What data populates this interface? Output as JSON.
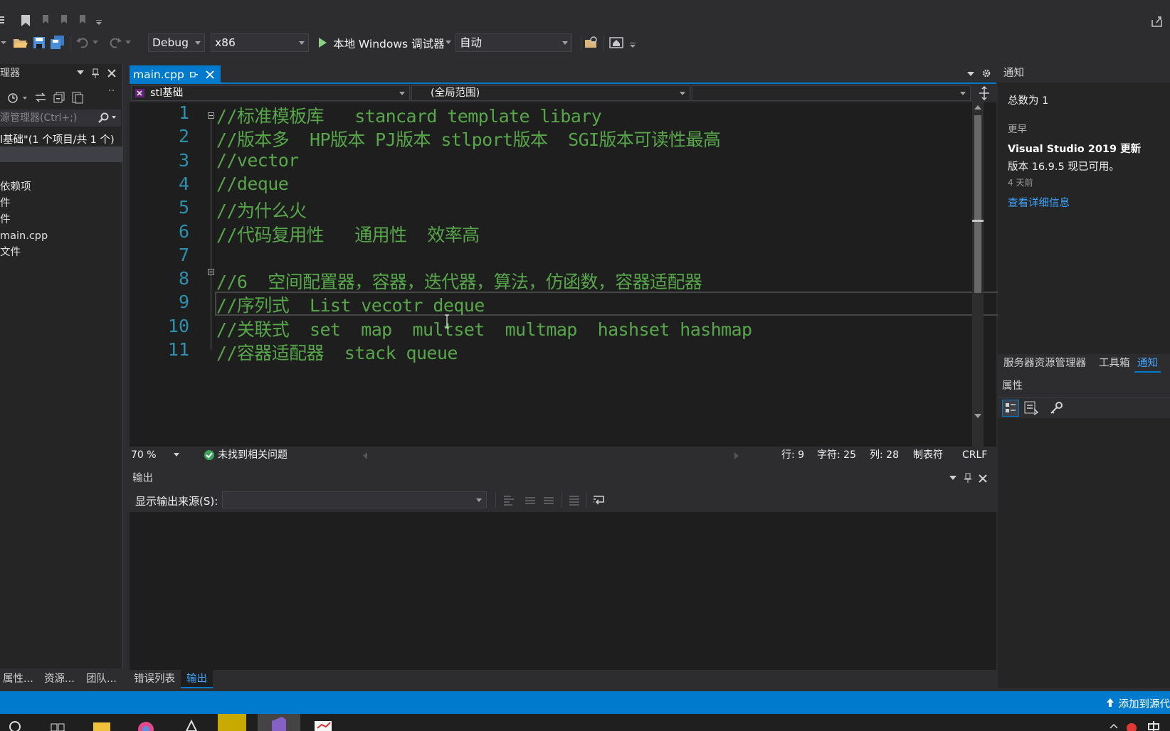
{
  "toolbar": {
    "config": "Debug",
    "platform": "x86",
    "debugger": "本地 Windows 调试器",
    "auto": "自动"
  },
  "solution_explorer": {
    "title": "理器",
    "search_placeholder": "源管理器(Ctrl+;)",
    "summary": "l基础\"(1 个项目/共 1 个)",
    "items": [
      "依赖项",
      "件",
      "件",
      "main.cpp",
      "文件"
    ]
  },
  "editor": {
    "tab_label": "main.cpp",
    "nav_project": "stl基础",
    "nav_scope": "(全局范围)",
    "lines": [
      {
        "n": "1",
        "text": "//标准模板库   stancard template libary"
      },
      {
        "n": "2",
        "text": "//版本多  HP版本 PJ版本 stlport版本  SGI版本可读性最高"
      },
      {
        "n": "3",
        "text": "//vector"
      },
      {
        "n": "4",
        "text": "//deque"
      },
      {
        "n": "5",
        "text": "//为什么火"
      },
      {
        "n": "6",
        "text": "//代码复用性   通用性  效率高"
      },
      {
        "n": "7",
        "text": ""
      },
      {
        "n": "8",
        "text": "//6  空间配置器，容器，迭代器，算法，仿函数，容器适配器"
      },
      {
        "n": "9",
        "text": "//序列式  List vecotr deque"
      },
      {
        "n": "10",
        "text": "//关联式  set  map  multset  multmap  hashset hashmap"
      },
      {
        "n": "11",
        "text": "//容器适配器  stack queue"
      }
    ],
    "zoom": "70 %",
    "issues": "未找到相关问题",
    "row": "行: 9",
    "char": "字符: 25",
    "col": "列: 28",
    "tabs_mode": "制表符",
    "eol": "CRLF"
  },
  "output": {
    "title": "输出",
    "source_label": "显示输出来源(S):"
  },
  "bottom_tabs": [
    "属性...",
    "资源...",
    "团队...",
    "错误列表",
    "输出"
  ],
  "notifications": {
    "title": "通知",
    "total": "总数为 1",
    "group": "更早",
    "item_title": "Visual Studio 2019 更新",
    "item_text": "版本 16.9.5 现已可用。",
    "item_time": "4 天前",
    "item_link": "查看详细信息"
  },
  "right_tabs": [
    "服务器资源管理器",
    "工具箱",
    "通知"
  ],
  "properties": {
    "title": "属性"
  },
  "statusbar": {
    "add_source": "添加到源代"
  },
  "colors": {
    "accent": "#007acc",
    "comment": "#57a64a",
    "line_number": "#2b91af",
    "link": "#3ea6ff"
  }
}
